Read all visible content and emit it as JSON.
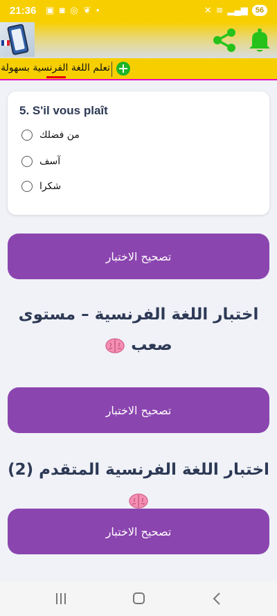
{
  "status_bar": {
    "time": "21:36",
    "left_icons": [
      "notification-icon",
      "screenshot-icon",
      "instagram-icon",
      "leaf-icon"
    ],
    "right_icons": [
      "mute-icon",
      "wifi-icon",
      "signal-icon"
    ],
    "battery": "56"
  },
  "top_bar": {
    "icons": [
      "share-icon",
      "bell-icon"
    ],
    "accent_color": "#f7cf00",
    "icon_color": "#26c21b"
  },
  "app_title": {
    "text": "تعلم اللغة الفرنسية بسهولة"
  },
  "question": {
    "title": "5. S'il vous plaît",
    "options": [
      "من فضلك",
      "آسف",
      "شكرا"
    ]
  },
  "buttons": {
    "check_label_1": "تصحيح الاختبار",
    "check_label_2": "تصحيح الاختبار",
    "check_label_3": "تصحيح الاختبار",
    "color": "#8b45af"
  },
  "headings": {
    "hard_quiz": "اختبار اللغة الفرنسية – مستوى صعب",
    "advanced_quiz": "اختبار اللغة الفرنسية المتقدم (2)"
  },
  "nav_bar": {
    "icons": [
      "recents-icon",
      "home-icon",
      "back-icon"
    ]
  }
}
